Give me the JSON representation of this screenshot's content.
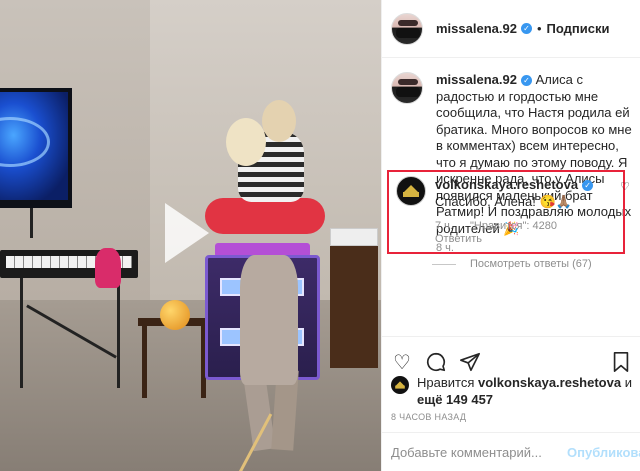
{
  "post": {
    "author": "missalena.92",
    "follow_label": "Подписки",
    "separator": "•"
  },
  "caption": {
    "author": "missalena.92",
    "text": "Алиса с радостью и гордостью мне сообщила, что Настя родила ей братика. Много вопросов ко мне в комментах) всем интересно, что я думаю по этому поводу. Я искренне рада, что у Алисы появился маленький брат Ратмир! И поздравляю молодых родителей 🎉",
    "time": "8 ч."
  },
  "reply": {
    "author": "volkonskaya.reshetova",
    "text": "Спасибо, Алена! 😘🙏🏽",
    "time": "7 ч.",
    "likes": "\"Нравится\": 4280",
    "reply_label": "Ответить"
  },
  "view_replies": "Посмотреть ответы (67)",
  "likes": {
    "prefix": "Нравится",
    "user": "volkonskaya.reshetova",
    "and": "и",
    "count": "ещё 149 457"
  },
  "timestamp": "8 ЧАСОВ НАЗАД",
  "composer": {
    "placeholder": "Добавьте комментарий...",
    "publish_label": "Опубликовать"
  },
  "icons": {
    "like": "heart-icon",
    "comment": "comment-icon",
    "share": "share-icon",
    "save": "bookmark-icon",
    "play": "play-icon",
    "verified": "verified-badge-icon"
  },
  "colors": {
    "highlight_box": "#e8233a",
    "verified": "#3897f0",
    "muted": "#8e8e8e",
    "publish_disabled": "#b2dffc"
  }
}
